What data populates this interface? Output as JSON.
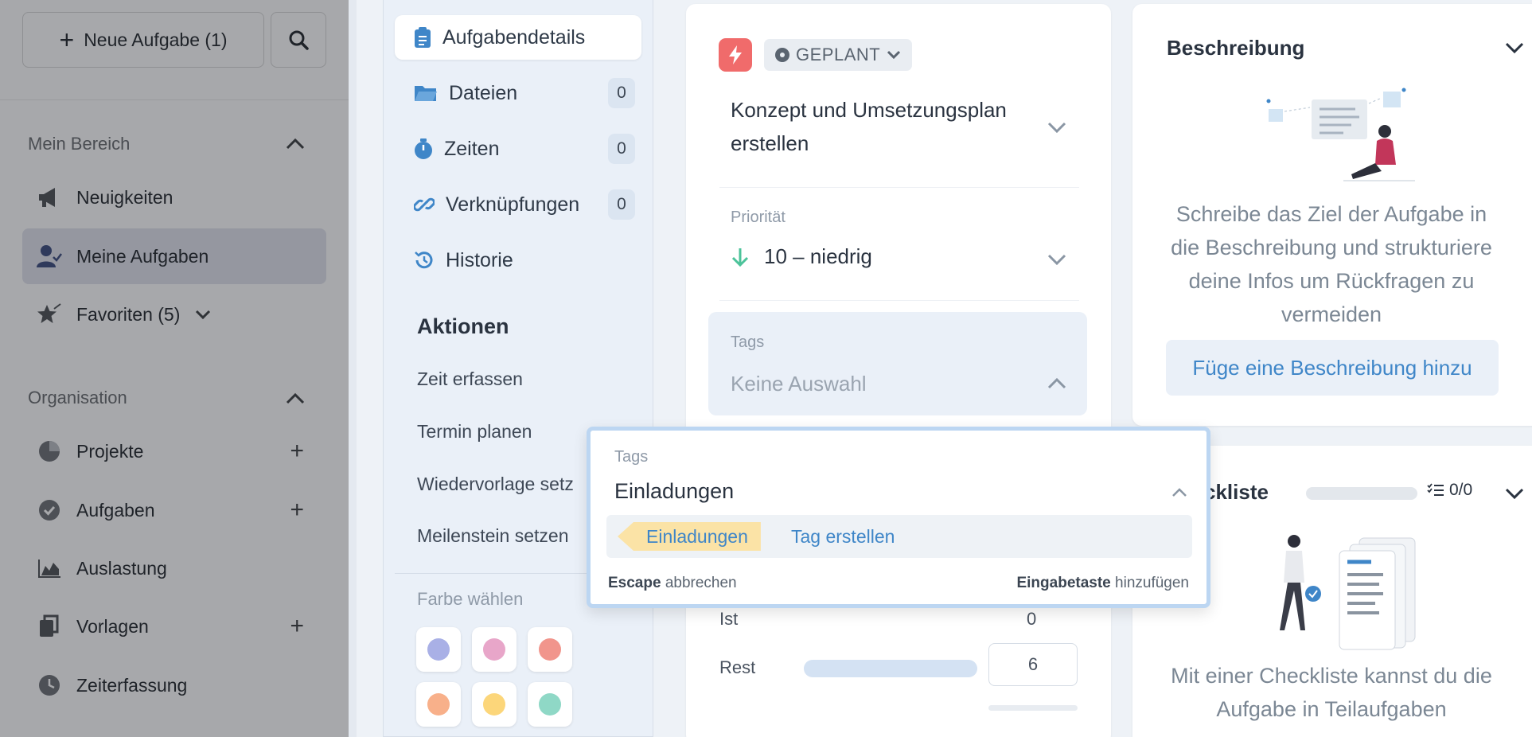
{
  "sidebar": {
    "new_task_label": "Neue Aufgabe (1)",
    "section_mine": "Mein Bereich",
    "section_org": "Organisation",
    "mine_items": [
      {
        "label": "Neuigkeiten",
        "icon": "megaphone-icon"
      },
      {
        "label": "Meine Aufgaben",
        "icon": "user-check-icon"
      },
      {
        "label": "Favoriten (5)",
        "icon": "star-icon"
      }
    ],
    "org_items": [
      {
        "label": "Projekte",
        "icon": "pie-chart-icon"
      },
      {
        "label": "Aufgaben",
        "icon": "check-circle-icon"
      },
      {
        "label": "Auslastung",
        "icon": "area-chart-icon"
      },
      {
        "label": "Vorlagen",
        "icon": "copy-icon"
      },
      {
        "label": "Zeiterfassung",
        "icon": "clock-icon"
      }
    ]
  },
  "tasknav": {
    "items": [
      {
        "label": "Aufgabendetails",
        "badge": null,
        "icon": "clipboard-icon"
      },
      {
        "label": "Dateien",
        "badge": "0",
        "icon": "folder-icon"
      },
      {
        "label": "Zeiten",
        "badge": "0",
        "icon": "stopwatch-icon"
      },
      {
        "label": "Verknüpfungen",
        "badge": "0",
        "icon": "link-icon"
      },
      {
        "label": "Historie",
        "badge": null,
        "icon": "history-icon"
      }
    ],
    "actions_heading": "Aktionen",
    "actions": [
      "Zeit erfassen",
      "Termin planen",
      "Wiedervorlage setz",
      "Meilenstein setzen"
    ],
    "color_label": "Farbe wählen",
    "colors": [
      "#a9b0e6",
      "#e8a6c9",
      "#f1958c",
      "#f8b08a",
      "#fcd67a",
      "#8fd8c6"
    ]
  },
  "task": {
    "status": "GEPLANT",
    "title": "Konzept und Umsetzungsplan erstellen",
    "priority_label": "Priorität",
    "priority_value": "10 – niedrig",
    "tags_label": "Tags",
    "tags_placeholder": "Keine Auswahl",
    "ist_label": "Ist",
    "ist_value": "0",
    "rest_label": "Rest",
    "rest_value": "6"
  },
  "description": {
    "title": "Beschreibung",
    "text": "Schreibe das Ziel der Aufgabe in die Beschreibung und strukturiere deine Infos um Rückfragen zu vermeiden",
    "button": "Füge eine Beschreibung hinzu"
  },
  "checklist": {
    "title": "ckliste",
    "count": "0/0",
    "text": "Mit einer Checkliste kannst du die Aufgabe in Teilaufgaben"
  },
  "popup": {
    "label": "Tags",
    "value": "Einladungen",
    "chip": "Einladungen",
    "create": "Tag erstellen",
    "hint_left_key": "Escape",
    "hint_left_text": "abbrechen",
    "hint_right_key": "Eingabetaste",
    "hint_right_text": "hinzufügen"
  },
  "colors": {
    "accent": "#3f86c8",
    "bolt": "#f06b6b",
    "priority_arrow": "#4cc39a",
    "tag_chip": "#fbe3a6"
  }
}
